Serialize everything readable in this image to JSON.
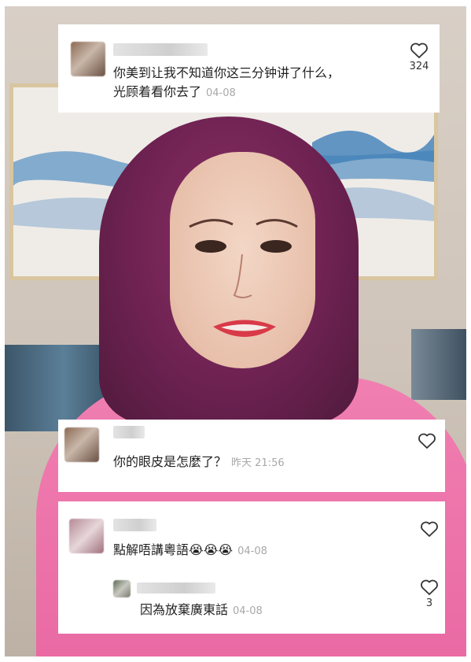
{
  "comments": [
    {
      "text_line1": "你美到让我不知道你这三分钟讲了什么，",
      "text_line2": "光顾着看你去了",
      "timestamp": "04-08",
      "likes": "324"
    },
    {
      "text": "你的眼皮是怎麼了？",
      "timestamp": "昨天 21:56",
      "likes": ""
    },
    {
      "text": "點解唔講粵語",
      "emojis": "😭😭😭",
      "timestamp": "04-08",
      "likes": "",
      "reply": {
        "text": "因為放棄廣東話",
        "timestamp": "04-08",
        "likes": "3"
      }
    }
  ],
  "icons": {
    "like": "heart-outline-icon"
  }
}
